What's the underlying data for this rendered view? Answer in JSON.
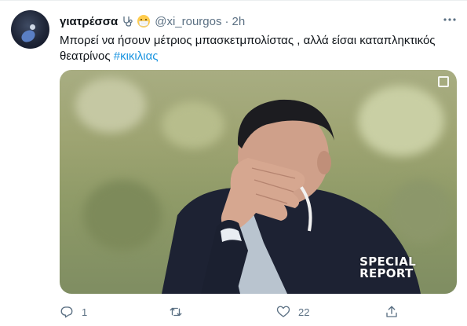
{
  "tweet": {
    "display_name": "γιατρέσσα",
    "name_emojis": [
      "stethoscope-emoji",
      "medical-mask-emoji"
    ],
    "handle": "@xi_rourgos",
    "separator": "·",
    "time": "2h",
    "text_prefix": "Μπορεί να ήσουν μέτριος μπασκετμπολίστας , αλλά είσαι καταπληκτικός θεατρίνος ",
    "hashtag": "#κικιλιας",
    "media": {
      "overlay_line1": "SPECIAL",
      "overlay_line2": "REPORT"
    },
    "actions": {
      "reply_count": "1",
      "retweet_count": "",
      "like_count": "22"
    },
    "icons": {
      "more": "more-horizontal-icon",
      "reply": "reply-icon",
      "retweet": "retweet-icon",
      "like": "heart-icon",
      "share": "share-icon"
    },
    "colors": {
      "hashtag": "#1b95e0",
      "secondary_text": "#5b7083",
      "primary_text": "#0f1419"
    }
  }
}
